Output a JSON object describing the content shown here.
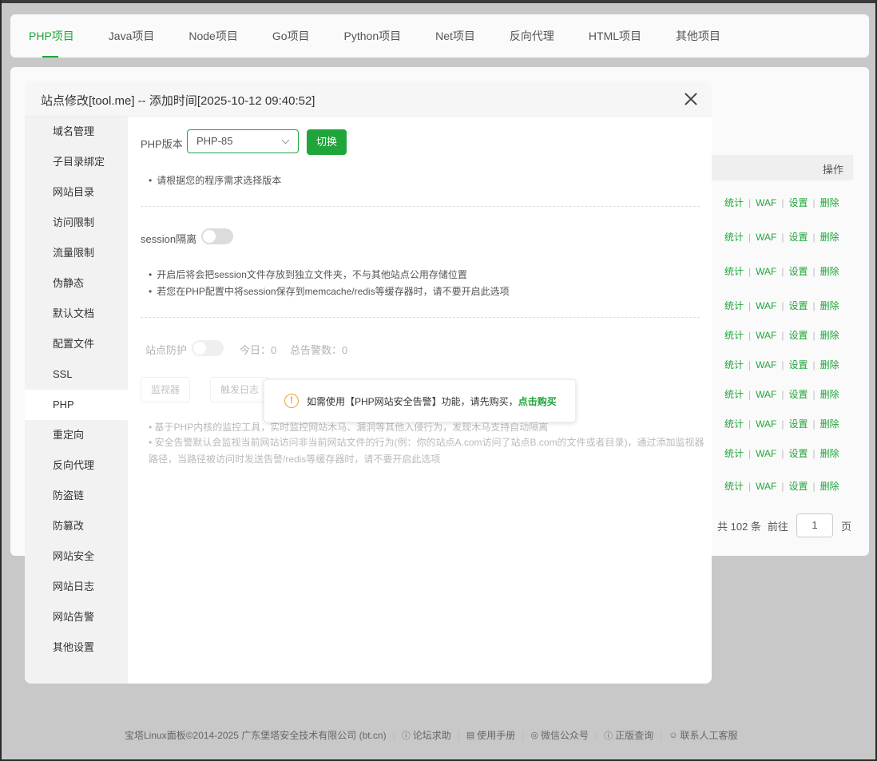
{
  "tabs": [
    "PHP项目",
    "Java项目",
    "Node项目",
    "Go项目",
    "Python项目",
    "Net项目",
    "反向代理",
    "HTML项目",
    "其他项目"
  ],
  "table": {
    "ops_header": "操作",
    "op_labels": [
      "统计",
      "WAF",
      "设置",
      "删除"
    ]
  },
  "pagination": {
    "total": "共 102 条",
    "goto": "前往",
    "page": "1",
    "page_suffix": "页"
  },
  "footer": {
    "copyright": "宝塔Linux面板©2014-2025 广东堡塔安全技术有限公司 (bt.cn)",
    "links": [
      "论坛求助",
      "使用手册",
      "微信公众号",
      "正版查询",
      "联系人工客服"
    ]
  },
  "dialog": {
    "title": "站点修改[tool.me] -- 添加时间[2025-10-12 09:40:52]",
    "sidebar": [
      "域名管理",
      "子目录绑定",
      "网站目录",
      "访问限制",
      "流量限制",
      "伪静态",
      "默认文档",
      "配置文件",
      "SSL",
      "PHP",
      "重定向",
      "反向代理",
      "防盗链",
      "防篡改",
      "网站安全",
      "网站日志",
      "网站告警",
      "其他设置"
    ],
    "php_version_label": "PHP版本",
    "php_version_value": "PHP-85",
    "switch_button": "切换",
    "version_tip": "请根据您的程序需求选择版本",
    "session_label": "session隔离",
    "session_tips": [
      "开启后将会把session文件存放到独立文件夹，不与其他站点公用存储位置",
      "若您在PHP配置中将session保存到memcache/redis等缓存器时，请不要开启此选项"
    ],
    "protect_label": "站点防护",
    "today_label": "今日：0",
    "total_alert_label": "总告警数：0",
    "monitor_button": "监视器",
    "trigger_log_button": "触发日志",
    "feature_tips": [
      "基于PHP内核的监控工具，实时监控网站木马、漏洞等其他入侵行为，发现木马支持自动隔离",
      "安全告警默认会监视当前网站访问非当前网站文件的行为(例：你的站点A.com访问了站点B.com的文件或者目录)，通过添加监视器路径，当路径被访问时发送告警/redis等缓存器时，请不要开启此选项"
    ],
    "popup_text": "如需使用【PHP网站安全告警】功能，请先购买，",
    "popup_link": "点击购买"
  },
  "colors": {
    "accent": "#20a53a",
    "warning": "#e6a23c"
  }
}
